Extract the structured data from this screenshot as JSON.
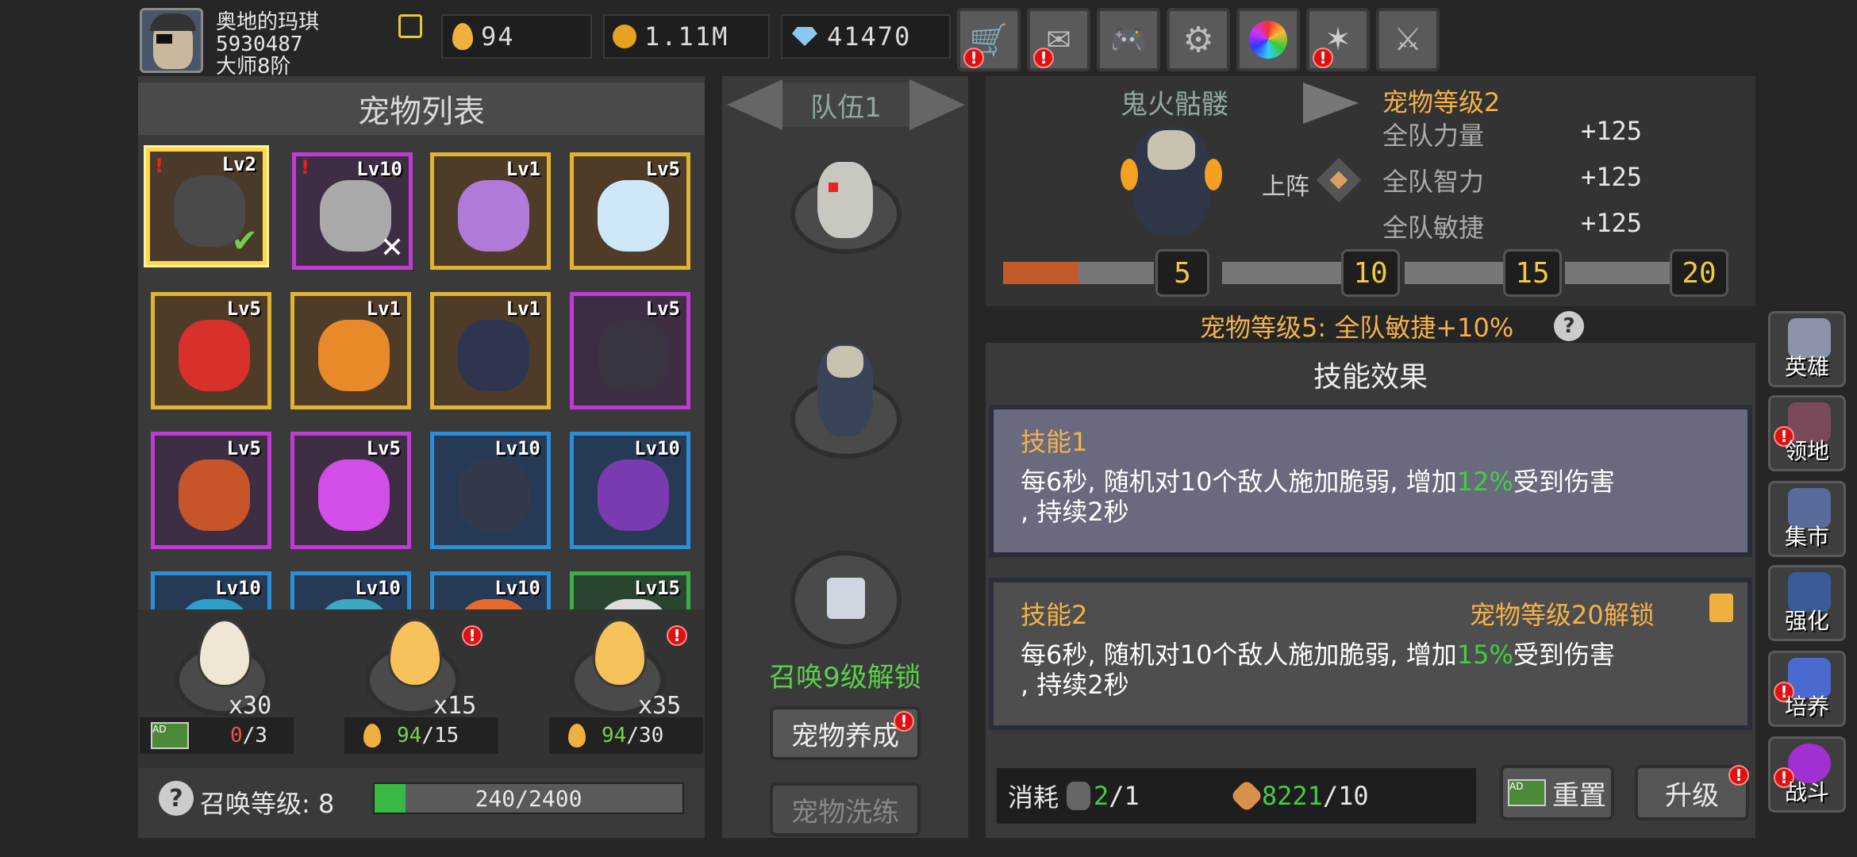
{
  "player": {
    "name": "奥地的玛琪",
    "id": "5930487",
    "rank": "大师8阶"
  },
  "resources": {
    "eggs": "94",
    "gold": "1.11M",
    "gems": "41470"
  },
  "top_icons": [
    "cart-icon",
    "mail-icon",
    "gamepad-icon",
    "gear-icon",
    "color-wheel-icon",
    "sparkle-icon",
    "swords-icon"
  ],
  "pet_list": {
    "title": "宠物列表",
    "slots": [
      {
        "lv": "Lv2",
        "frame": "gold",
        "color": "#6b6b6b"
      },
      {
        "lv": "Lv10",
        "frame": "purple",
        "color": "#bfbfbf"
      },
      {
        "lv": "Lv1",
        "frame": "gold",
        "color": "#b07ad8"
      },
      {
        "lv": "Lv5",
        "frame": "gold",
        "color": "#cfe8f8"
      },
      {
        "lv": "Lv5",
        "frame": "gold",
        "color": "#d8302a"
      },
      {
        "lv": "Lv1",
        "frame": "gold",
        "color": "#e88a2a"
      },
      {
        "lv": "Lv1",
        "frame": "gold",
        "color": "#2e3550"
      },
      {
        "lv": "Lv5",
        "frame": "purple",
        "color": "#3a3340"
      },
      {
        "lv": "Lv5",
        "frame": "purple",
        "color": "#c8552a"
      },
      {
        "lv": "Lv5",
        "frame": "purple",
        "color": "#d24ee8"
      },
      {
        "lv": "Lv10",
        "frame": "blue",
        "color": "#33394a"
      },
      {
        "lv": "Lv10",
        "frame": "blue",
        "color": "#7a3ab0"
      },
      {
        "lv": "Lv10",
        "frame": "blue",
        "color": "#2aa0c8"
      },
      {
        "lv": "Lv10",
        "frame": "blue",
        "color": "#3aa8c0"
      },
      {
        "lv": "Lv10",
        "frame": "blue",
        "color": "#e86a2a"
      },
      {
        "lv": "Lv15",
        "frame": "green",
        "color": "#ddd"
      }
    ]
  },
  "eggs": [
    {
      "count": "x30",
      "cost_have": "0",
      "cost_need": "/3"
    },
    {
      "count": "x15",
      "cost_have": "94",
      "cost_need": "/15"
    },
    {
      "count": "x35",
      "cost_have": "94",
      "cost_need": "/30"
    }
  ],
  "summon": {
    "label": "召唤等级: 8",
    "progress": "240/2400",
    "fraction": 0.1
  },
  "team": {
    "title": "队伍1",
    "unlock": "召唤9级解锁",
    "train_btn": "宠物养成",
    "wash_btn": "宠物洗练"
  },
  "pet_detail": {
    "name": "鬼火骷髅",
    "level_title": "宠物等级2",
    "deploy": "上阵",
    "stats": [
      {
        "label": "全队力量",
        "value": "+125"
      },
      {
        "label": "全队智力",
        "value": "+125"
      },
      {
        "label": "全队敏捷",
        "value": "+125"
      }
    ],
    "milestones": [
      "5",
      "10",
      "15",
      "20"
    ],
    "bonus": "宠物等级5: 全队敏捷+10%"
  },
  "skills": {
    "title": "技能效果",
    "skill1": {
      "name": "技能1",
      "desc_a": "每6秒, 随机对10个敌人施加脆弱, 增加",
      "pct": "12%",
      "desc_b": "受到伤害",
      "desc_c": ", 持续2秒"
    },
    "skill2": {
      "name": "技能2",
      "lock": "宠物等级20解锁",
      "desc_a": "每6秒, 随机对10个敌人施加脆弱, 增加",
      "pct": "15%",
      "desc_b": "受到伤害",
      "desc_c": ", 持续2秒"
    }
  },
  "cost": {
    "label": "消耗",
    "item1_have": "2",
    "item1_need": "/1",
    "item2_have": "8221",
    "item2_need": "/10"
  },
  "buttons": {
    "reset": "重置",
    "upgrade": "升级"
  },
  "side_nav": [
    {
      "label": "英雄",
      "icon": "helmet-icon",
      "color": "#8a93a8"
    },
    {
      "label": "领地",
      "icon": "castle-icon",
      "color": "#7a4a5a"
    },
    {
      "label": "集市",
      "icon": "shop-icon",
      "color": "#5a6a9a"
    },
    {
      "label": "强化",
      "icon": "crystal-icon",
      "color": "#3a5a9a"
    },
    {
      "label": "培养",
      "icon": "chalice-icon",
      "color": "#4a6ad0"
    },
    {
      "label": "战斗",
      "icon": "portal-icon",
      "color": "#a030d0"
    }
  ]
}
